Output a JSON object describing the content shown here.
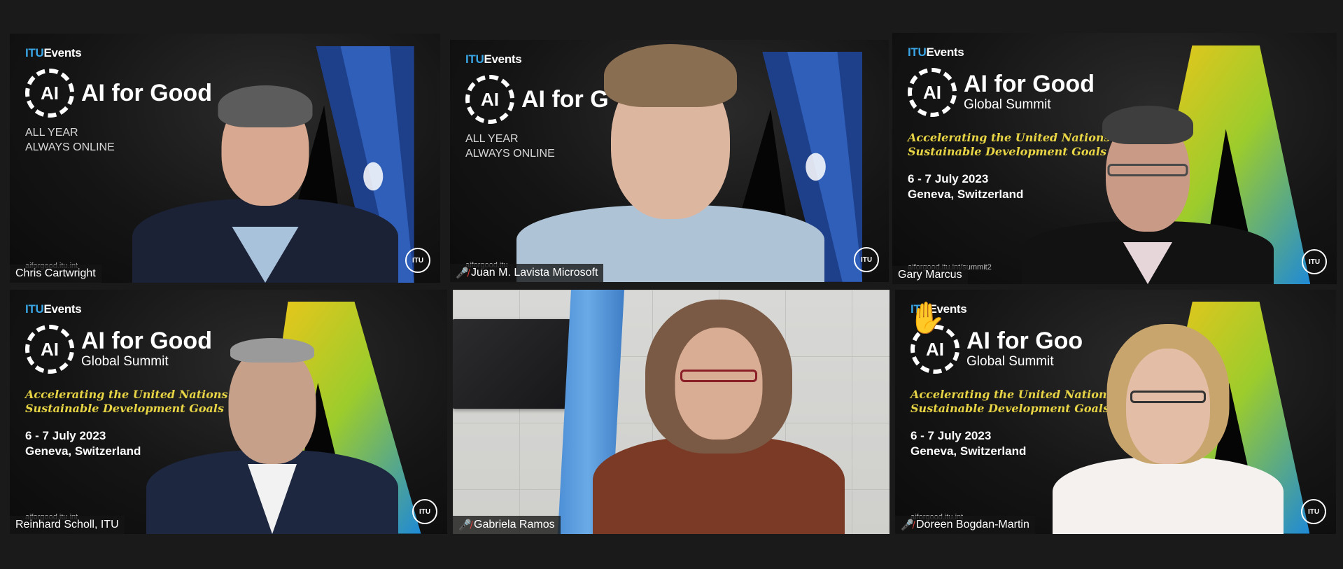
{
  "meeting": {
    "participants": [
      {
        "name": "Chris Cartwright",
        "muted": false,
        "active_speaker": false,
        "raised_hand": false,
        "background": {
          "brand": "ITU",
          "brand_suffix": "Events",
          "badge": "AI",
          "title": "AI for Good",
          "lines": [
            "ALL YEAR",
            "ALWAYS ONLINE"
          ],
          "url": "aiforgood.itu.int"
        }
      },
      {
        "name": "Juan M. Lavista Microsoft",
        "muted": true,
        "active_speaker": false,
        "raised_hand": false,
        "background": {
          "brand": "ITU",
          "brand_suffix": "Events",
          "badge": "AI",
          "title": "AI for G",
          "lines": [
            "ALL YEAR",
            "ALWAYS ONLINE"
          ],
          "url": "aiforgood.itu"
        }
      },
      {
        "name": "Gary Marcus",
        "muted": false,
        "active_speaker": true,
        "raised_hand": false,
        "background": {
          "brand": "ITU",
          "brand_suffix": "Events",
          "badge": "AI",
          "title": "AI for Good",
          "subtitle": "Global Summit",
          "tagline": [
            "Accelerating the United Nations",
            "Sustainable Development Goals"
          ],
          "dates": [
            "6 - 7 July 2023",
            "Geneva, Switzerland"
          ],
          "url": "aiforgood.itu.int/summit2"
        }
      },
      {
        "name": "Reinhard Scholl, ITU",
        "muted": false,
        "active_speaker": false,
        "raised_hand": false,
        "background": {
          "brand": "ITU",
          "brand_suffix": "Events",
          "badge": "AI",
          "title": "AI for Good",
          "subtitle": "Global Summit",
          "tagline": [
            "Accelerating the United Nations",
            "Sustainable Development Goals"
          ],
          "dates": [
            "6 - 7 July 2023",
            "Geneva, Switzerland"
          ],
          "url": "aiforgood.itu.int"
        }
      },
      {
        "name": "Gabriela Ramos",
        "muted": true,
        "active_speaker": false,
        "raised_hand": false
      },
      {
        "name": "Doreen Bogdan-Martin",
        "muted": true,
        "active_speaker": false,
        "raised_hand": true,
        "background": {
          "brand": "ITU",
          "brand_suffix": "Events",
          "badge": "AI",
          "title": "AI for Goo",
          "subtitle": "Global Summit",
          "tagline": [
            "Accelerating the United Nations",
            "Sustainable Development Goals"
          ],
          "dates": [
            "6 - 7 July 2023",
            "Geneva, Switzerland"
          ],
          "url": "aiforgood.itu.int"
        }
      }
    ],
    "icons": {
      "muted": "mic-off-icon",
      "raised_hand": "raised-hand-icon",
      "itu_mark": "itu-logo-icon"
    },
    "colors": {
      "active_speaker_border": "#c9e37a",
      "muted_icon": "#e0403a",
      "tagline": "#e8d545",
      "itu_blue": "#3aa6e6",
      "window_bg": "#1a1a1a"
    }
  }
}
